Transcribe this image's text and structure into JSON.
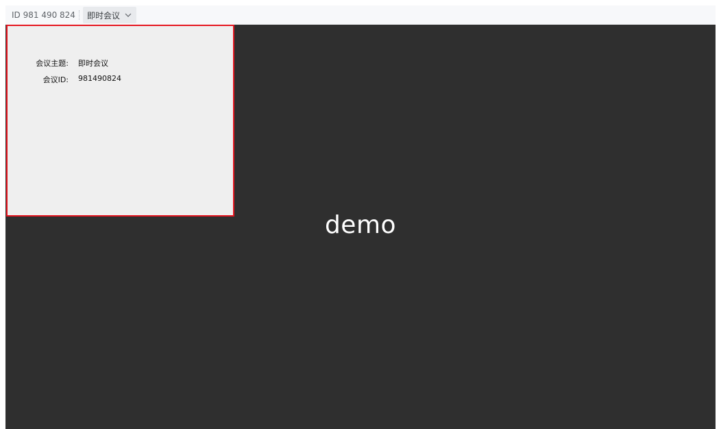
{
  "topbar": {
    "meeting_id": "ID 981 490 824",
    "topic_button": "即时会议",
    "dropdown_icon": "chevron-down-icon"
  },
  "stage": {
    "label": "demo"
  },
  "info_panel": {
    "topic_label": "会议主题:",
    "topic_value": "即时会议",
    "id_label": "会议ID:",
    "id_value": "981490824",
    "border_color": "#e5141e"
  },
  "colors": {
    "stage_background": "#2f2f2f",
    "panel_background": "#efefef",
    "topbar_background": "#f7f8fa"
  }
}
